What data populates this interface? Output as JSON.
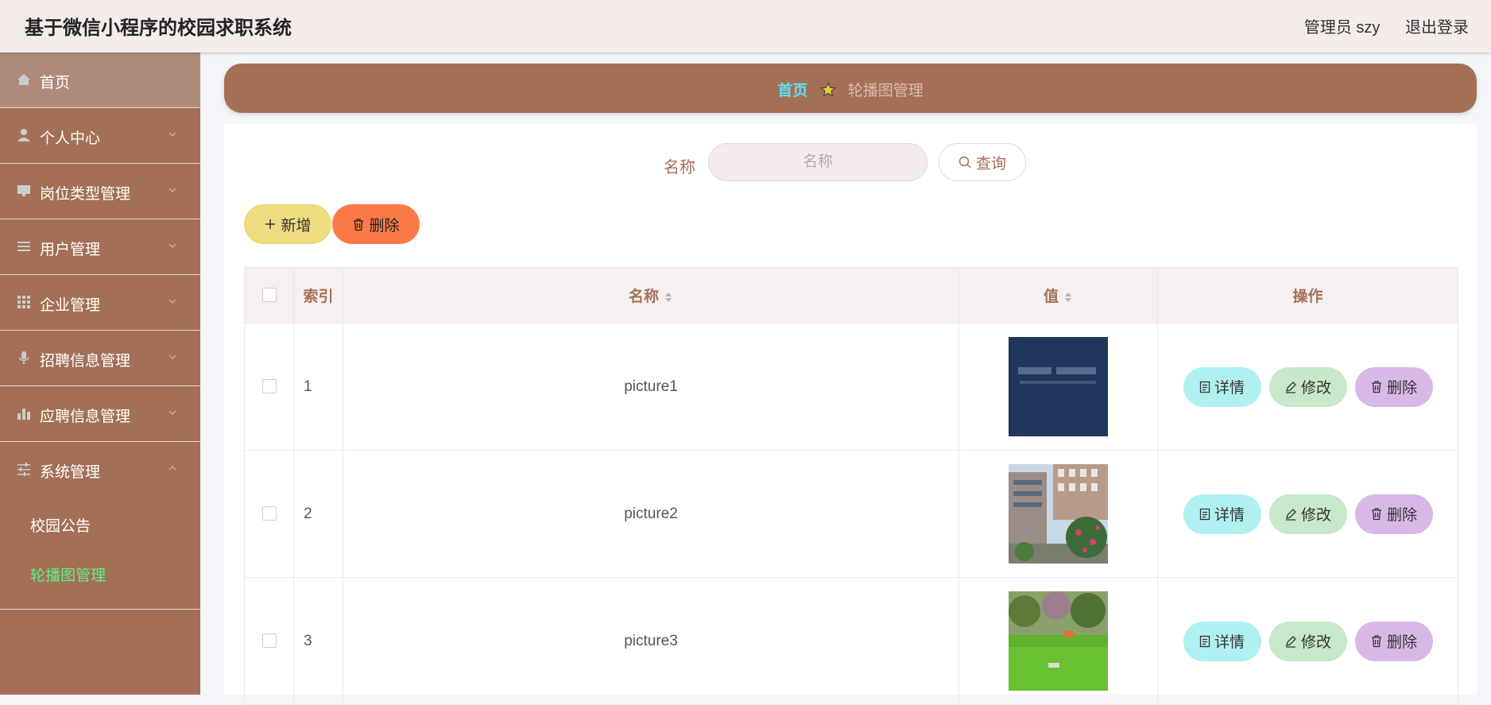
{
  "header": {
    "title": "基于微信小程序的校园求职系统",
    "user_label": "管理员 szy",
    "logout_label": "退出登录"
  },
  "sidebar": {
    "items": [
      {
        "label": "首页",
        "icon": "home-icon"
      },
      {
        "label": "个人中心",
        "icon": "user-icon"
      },
      {
        "label": "岗位类型管理",
        "icon": "monitor-icon"
      },
      {
        "label": "用户管理",
        "icon": "list-icon"
      },
      {
        "label": "企业管理",
        "icon": "grid-icon"
      },
      {
        "label": "招聘信息管理",
        "icon": "microphone-icon"
      },
      {
        "label": "应聘信息管理",
        "icon": "bar-chart-icon"
      },
      {
        "label": "系统管理",
        "icon": "sliders-icon"
      }
    ],
    "sub_items": [
      {
        "label": "校园公告"
      },
      {
        "label": "轮播图管理"
      }
    ]
  },
  "breadcrumb": {
    "home": "首页",
    "current": "轮播图管理"
  },
  "search": {
    "label": "名称",
    "placeholder": "名称",
    "query_label": "查询"
  },
  "toolbar": {
    "add_label": "新增",
    "delete_label": "删除"
  },
  "table": {
    "columns": [
      "索引",
      "名称",
      "值",
      "操作"
    ],
    "rows": [
      {
        "index": "1",
        "name": "picture1"
      },
      {
        "index": "2",
        "name": "picture2"
      },
      {
        "index": "3",
        "name": "picture3"
      }
    ],
    "actions": {
      "detail": "详情",
      "edit": "修改",
      "delete": "删除"
    }
  },
  "colors": {
    "brand": "#a37057",
    "header_bg": "#f3eceb",
    "breadcrumb_home": "#5fe1ef",
    "active_sub_item": "#5ef08a",
    "add_button": "#eedc81",
    "delete_button": "#fb7a48",
    "detail_button": "#b0f0f0",
    "edit_button": "#c7e8c9",
    "row_delete_button": "#d8b8e6"
  }
}
